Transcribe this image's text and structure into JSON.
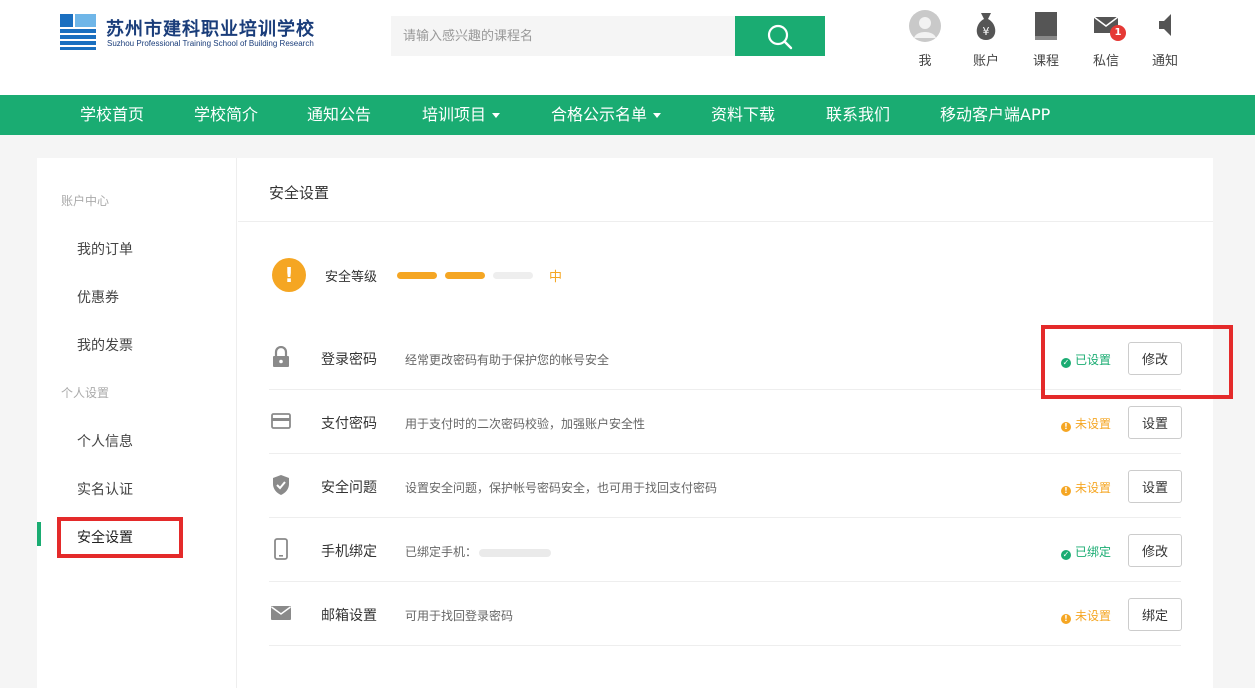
{
  "header": {
    "logo_cn": "苏州市建科职业培训学校",
    "logo_en": "Suzhou Professional Training School of Building Research",
    "search_placeholder": "请输入感兴趣的课程名",
    "icons": [
      {
        "label": "我",
        "icon": "avatar-icon"
      },
      {
        "label": "账户",
        "icon": "money-bag-icon"
      },
      {
        "label": "课程",
        "icon": "book-icon"
      },
      {
        "label": "私信",
        "icon": "mail-icon",
        "badge": "1"
      },
      {
        "label": "通知",
        "icon": "speaker-icon"
      }
    ]
  },
  "nav": {
    "items": [
      {
        "label": "学校首页"
      },
      {
        "label": "学校简介"
      },
      {
        "label": "通知公告"
      },
      {
        "label": "培训项目",
        "dropdown": true
      },
      {
        "label": "合格公示名单",
        "dropdown": true
      },
      {
        "label": "资料下载"
      },
      {
        "label": "联系我们"
      },
      {
        "label": "移动客户端APP"
      }
    ]
  },
  "sidebar": {
    "group1": "账户中心",
    "items1": [
      "我的订单",
      "优惠券",
      "我的发票"
    ],
    "group2": "个人设置",
    "items2": [
      "个人信息",
      "实名认证",
      "安全设置"
    ],
    "active": "安全设置"
  },
  "main": {
    "title": "安全设置",
    "level": {
      "label": "安全等级",
      "value": "中",
      "filled_segments": 2,
      "total_segments": 3
    },
    "rows": [
      {
        "icon": "lock-icon",
        "name": "登录密码",
        "desc": "经常更改密码有助于保护您的帐号安全",
        "status": "已设置",
        "status_type": "ok",
        "button": "修改"
      },
      {
        "icon": "card-icon",
        "name": "支付密码",
        "desc": "用于支付时的二次密码校验，加强账户安全性",
        "status": "未设置",
        "status_type": "warn",
        "button": "设置"
      },
      {
        "icon": "shield-icon",
        "name": "安全问题",
        "desc": "设置安全问题，保护帐号密码安全，也可用于找回支付密码",
        "status": "未设置",
        "status_type": "warn",
        "button": "设置"
      },
      {
        "icon": "phone-icon",
        "name": "手机绑定",
        "desc": "已绑定手机：",
        "status": "已绑定",
        "status_type": "ok",
        "button": "修改"
      },
      {
        "icon": "envelope-icon",
        "name": "邮箱设置",
        "desc": "可用于找回登录密码",
        "status": "未设置",
        "status_type": "warn",
        "button": "绑定"
      }
    ]
  },
  "colors": {
    "brand_green": "#1aac72",
    "warn_orange": "#f5a623",
    "highlight_red": "#e42a2a"
  }
}
